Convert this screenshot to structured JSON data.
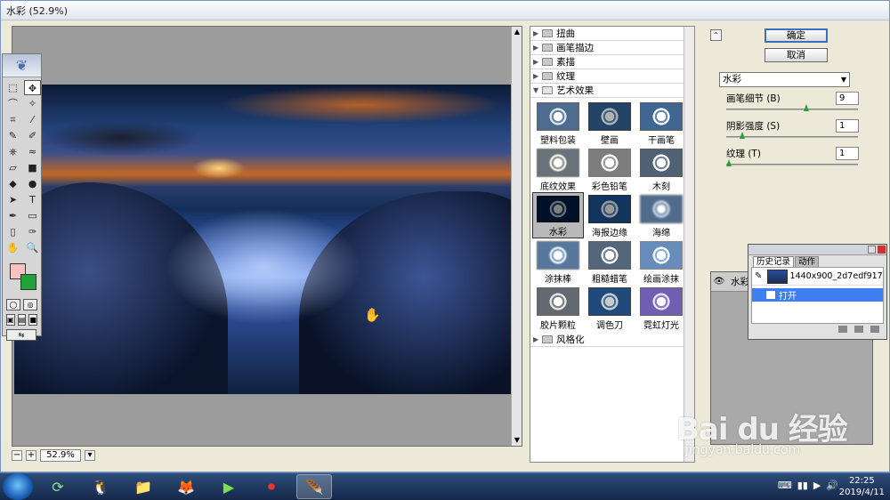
{
  "window": {
    "title": "水彩 (52.9%)"
  },
  "preview": {
    "zoom": "52.9%"
  },
  "toolbox": {
    "tools": [
      "⬚",
      "✥",
      "⌒",
      "✧",
      "⌗",
      "⁄",
      "✎",
      "✐",
      "⎈",
      "≈",
      "▱",
      "■",
      "◆",
      "●",
      "➤",
      "T",
      "✒",
      "▭",
      "▯",
      "✑",
      "✋",
      "🔍"
    ],
    "fg_color": "#f7c2c2",
    "bg_color": "#1fa33a"
  },
  "gallery": {
    "categories_top": [
      "扭曲",
      "画笔描边",
      "素描",
      "纹理",
      "艺术效果"
    ],
    "thumbnails": [
      "塑料包装",
      "壁画",
      "干画笔",
      "底纹效果",
      "彩色铅笔",
      "木刻",
      "水彩",
      "海报边缘",
      "海绵",
      "涂抹棒",
      "粗糙蜡笔",
      "绘画涂抹",
      "胶片颗粒",
      "调色刀",
      "霓虹灯光"
    ],
    "selected": "水彩",
    "category_bottom": "风格化"
  },
  "buttons": {
    "ok": "确定",
    "cancel": "取消"
  },
  "filter_select": "水彩",
  "params": [
    {
      "label": "画笔细节 (B)",
      "value": "9",
      "fraction": 0.6
    },
    {
      "label": "阴影强度 (S)",
      "value": "1",
      "fraction": 0.1
    },
    {
      "label": "纹理 (T)",
      "value": "1",
      "fraction": 0.0
    }
  ],
  "layer": {
    "name": "水彩",
    "eye": "👁"
  },
  "history": {
    "tabs": [
      "历史记录",
      "动作"
    ],
    "snapshot": "1440x900_2d7edf917d...",
    "step": "打开"
  },
  "watermark": {
    "logo": "Bai du 经验",
    "sub": "jingyan.baidu.com"
  },
  "taskbar": {
    "apps": [
      "⟳",
      "🐧",
      "📁",
      "🦊",
      "▶",
      "⏺",
      "🪶"
    ],
    "tray": [
      "⌨",
      "▮▮",
      "▶",
      "🔊"
    ],
    "time": "22:25",
    "date": "2019/4/11"
  }
}
